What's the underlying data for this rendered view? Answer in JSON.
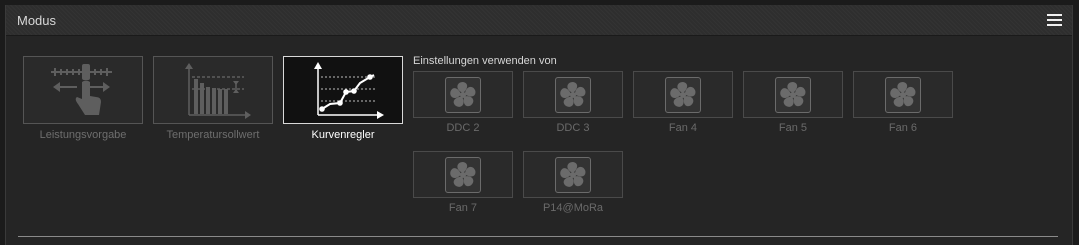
{
  "header": {
    "title": "Modus",
    "menu_icon": "hamburger-menu-icon"
  },
  "modes": [
    {
      "label": "Leistungsvorgabe",
      "icon": "power-preset-icon",
      "active": false
    },
    {
      "label": "Temperatursollwert",
      "icon": "temperature-setpoint-icon",
      "active": false
    },
    {
      "label": "Kurvenregler",
      "icon": "curve-controller-icon",
      "active": true
    }
  ],
  "sources": {
    "heading": "Einstellungen verwenden von",
    "items": [
      {
        "label": "DDC 2",
        "icon": "fan-icon"
      },
      {
        "label": "DDC 3",
        "icon": "fan-icon"
      },
      {
        "label": "Fan 4",
        "icon": "fan-icon"
      },
      {
        "label": "Fan 5",
        "icon": "fan-icon"
      },
      {
        "label": "Fan 6",
        "icon": "fan-icon"
      },
      {
        "label": "Fan 7",
        "icon": "fan-icon"
      },
      {
        "label": "P14@MoRa",
        "icon": "fan-icon"
      }
    ]
  },
  "colors": {
    "background": "#252525",
    "active_border": "#d9d9d9",
    "inactive_text": "#6e6e6e",
    "active_text": "#ffffff"
  }
}
